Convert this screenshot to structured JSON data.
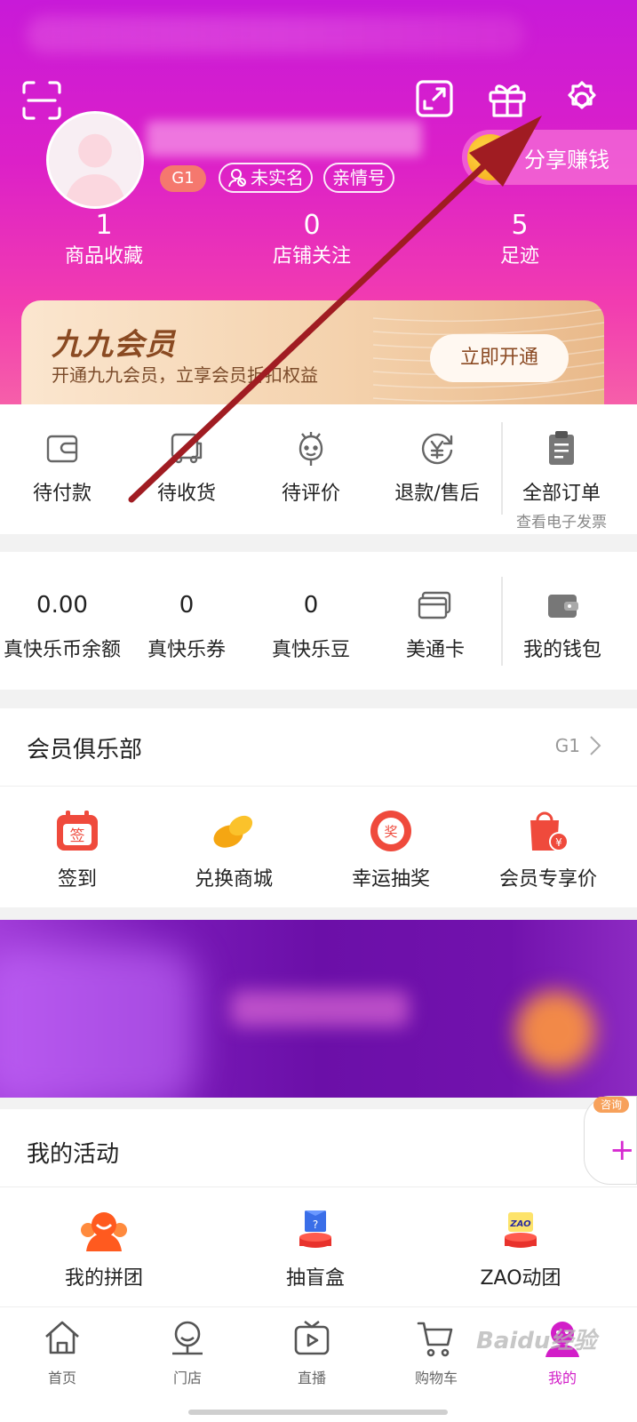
{
  "header": {
    "badge_level": "G1",
    "realname_label": "未实名",
    "family_label": "亲情号",
    "share_label": "分享赚钱",
    "stats": [
      {
        "value": "1",
        "label": "商品收藏"
      },
      {
        "value": "0",
        "label": "店铺关注"
      },
      {
        "value": "5",
        "label": "足迹"
      }
    ],
    "vip": {
      "title": "九九会员",
      "subtitle": "开通九九会员，立享会员折扣权益",
      "button": "立即开通"
    },
    "icons": [
      "scan-icon",
      "external-link-icon",
      "gift-icon",
      "settings-icon"
    ]
  },
  "orders": {
    "items": [
      {
        "label": "待付款",
        "icon": "wallet-icon"
      },
      {
        "label": "待收货",
        "icon": "truck-icon"
      },
      {
        "label": "待评价",
        "icon": "smile-flower-icon"
      },
      {
        "label": "退款/售后",
        "icon": "refund-icon"
      }
    ],
    "all": {
      "label": "全部订单",
      "sub": "查看电子发票",
      "icon": "clipboard-icon"
    }
  },
  "wallet": {
    "items": [
      {
        "value": "0.00",
        "label": "真快乐币余额"
      },
      {
        "value": "0",
        "label": "真快乐券"
      },
      {
        "value": "0",
        "label": "真快乐豆"
      },
      {
        "label": "美通卡",
        "icon": "card-icon"
      }
    ],
    "my_wallet": {
      "label": "我的钱包",
      "icon": "wallet-icon"
    }
  },
  "club": {
    "title": "会员俱乐部",
    "level": "G1",
    "items": [
      {
        "label": "签到",
        "icon_text": "签"
      },
      {
        "label": "兑换商城"
      },
      {
        "label": "幸运抽奖",
        "icon_text": "奖"
      },
      {
        "label": "会员专享价",
        "icon_text": "¥"
      }
    ]
  },
  "float_help": {
    "tag": "咨询",
    "plus": "+"
  },
  "activities": {
    "title": "我的活动",
    "items": [
      {
        "label": "我的拼团"
      },
      {
        "label": "抽盲盒"
      },
      {
        "label": "ZAO动团",
        "icon_text": "ZAO"
      }
    ]
  },
  "tabbar": {
    "items": [
      {
        "label": "首页",
        "icon": "home-icon"
      },
      {
        "label": "门店",
        "icon": "store-icon"
      },
      {
        "label": "直播",
        "icon": "live-tv-icon"
      },
      {
        "label": "购物车",
        "icon": "cart-icon"
      },
      {
        "label": "我的",
        "icon": "profile-icon",
        "active": true
      }
    ]
  },
  "watermark": "Baidu经验",
  "colors": {
    "header_gradient_top": "#c81ad8",
    "header_gradient_bottom": "#f65fa9",
    "accent": "#d21ec8",
    "icon_red": "#ef4a3c",
    "arrow": "#a01c22"
  }
}
